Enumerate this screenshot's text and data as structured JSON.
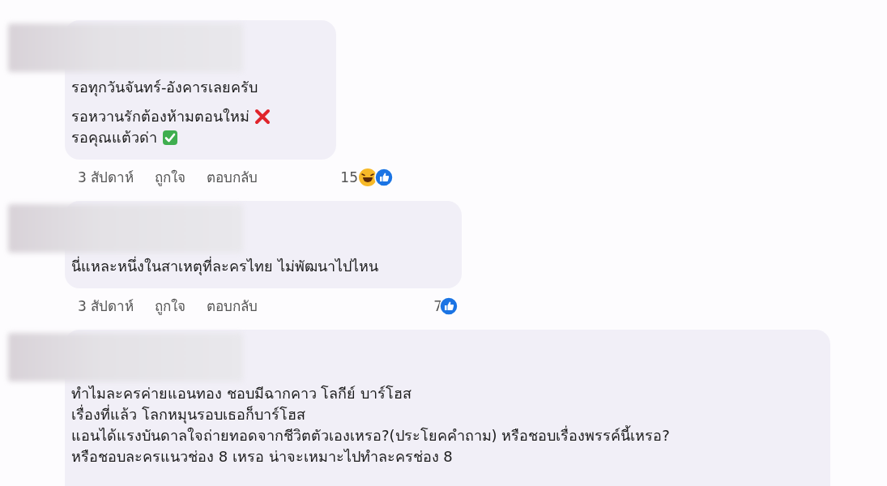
{
  "comments": [
    {
      "paragraphs": [
        {
          "lines": [
            {
              "text": "รอทุกวันจันทร์-อังคารเลยครับ",
              "kind": "text"
            }
          ]
        },
        {
          "lines": [
            {
              "text": "รอหวานรักต้องห้ามตอนใหม่",
              "kind": "cross"
            },
            {
              "text": "รอคุณแต้วด่า",
              "kind": "check"
            }
          ]
        }
      ],
      "time": "3 สัปดาห์",
      "like": "ถูกใจ",
      "reply": "ตอบกลับ",
      "reaction_count": "15",
      "reactions": [
        {
          "kind": "haha"
        },
        {
          "kind": "like"
        }
      ]
    },
    {
      "paragraphs": [
        {
          "lines": [
            {
              "text": "นี่แหละหนึ่งในสาเหตุที่ละครไทย ไม่พัฒนาไปไหน",
              "kind": "text"
            }
          ]
        }
      ],
      "time": "3 สัปดาห์",
      "like": "ถูกใจ",
      "reply": "ตอบกลับ",
      "reaction_count": "7",
      "reactions": [
        {
          "kind": "like"
        }
      ]
    },
    {
      "paragraphs": [
        {
          "lines": [
            {
              "text": "ทำไมละครค่ายแอนทอง ชอบมีฉากคาว โลกีย์ บาร์โฮส",
              "kind": "text"
            },
            {
              "text": "เรื่องที่แล้ว โลกหมุนรอบเธอก็บาร์โฮส",
              "kind": "text"
            },
            {
              "text": "แอนได้แรงบันดาลใจถ่ายทอดจากชีวิตตัวเองเหรอ?(ประโยคคำถาม) หรือชอบเรื่องพรรค์นี้เหรอ?",
              "kind": "text"
            },
            {
              "text": "หรือชอบละครแนวช่อง 8 เหรอ น่าจะเหมาะไปทำละครช่อง 8",
              "kind": "text"
            }
          ]
        }
      ]
    }
  ]
}
